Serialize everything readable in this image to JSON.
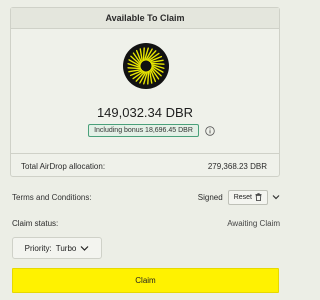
{
  "card": {
    "title": "Available To Claim",
    "amount": "149,032.34 DBR",
    "bonus": "Including bonus 18,696.45 DBR",
    "allocation_label": "Total AirDrop allocation:",
    "allocation_value": "279,368.23 DBR"
  },
  "terms": {
    "label": "Terms and Conditions:",
    "status": "Signed",
    "reset_label": "Reset"
  },
  "claim_status": {
    "label": "Claim status:",
    "value": "Awaiting Claim"
  },
  "priority": {
    "label": "Priority:",
    "value": "Turbo"
  },
  "claim_button": {
    "label": "Claim"
  },
  "colors": {
    "background": "#eceee6",
    "accent_yellow": "#fff200",
    "badge_border": "#4aa07a",
    "logo_bg": "#111111",
    "logo_fg": "#e8e600"
  },
  "icons": {
    "logo": "token-logo-icon",
    "info": "info-icon",
    "reset": "trash-icon",
    "expand": "chevron-down-icon",
    "priority": "chevron-down-icon"
  }
}
